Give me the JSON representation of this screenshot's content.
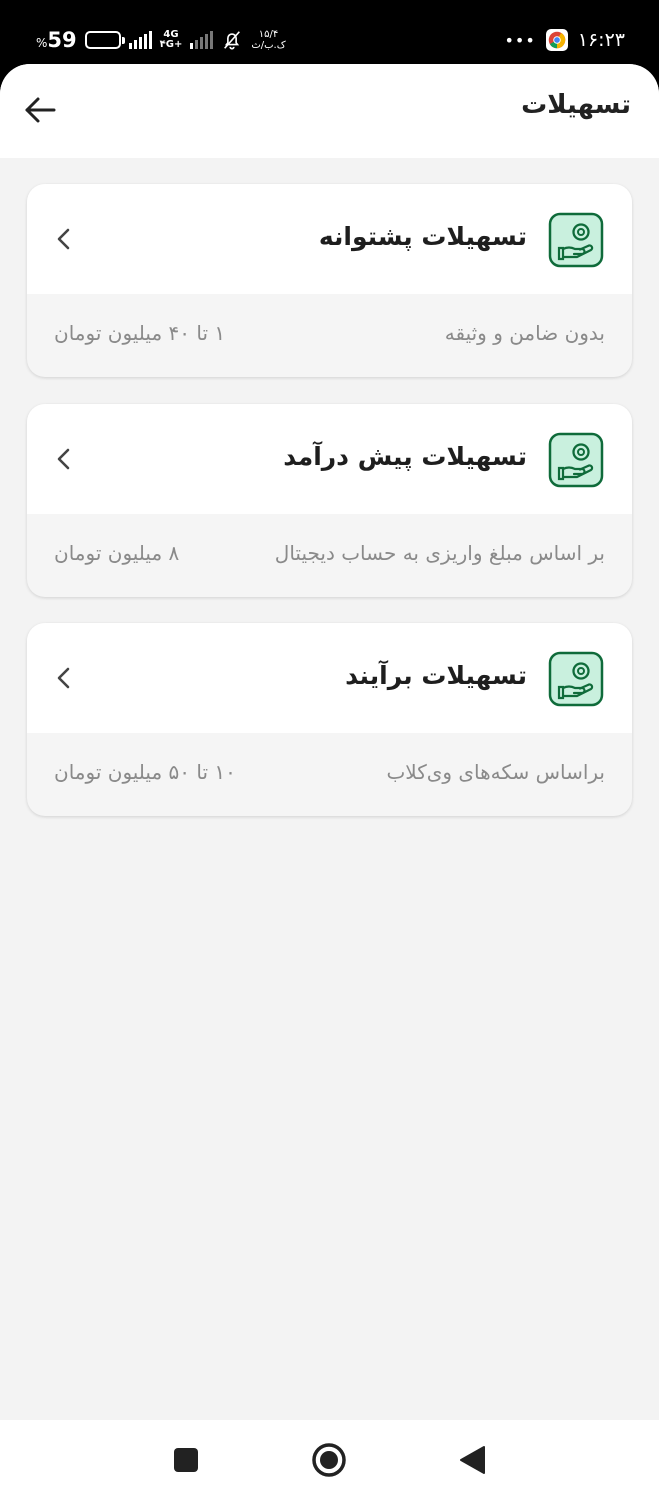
{
  "status_bar": {
    "battery_percent": "59",
    "battery_unit": "%",
    "network_type": "4G",
    "network_sub": "۴G+",
    "data_speed_value": "۱۵/۴",
    "data_speed_unit": "ک.ب/ث",
    "overflow_dots": "•••",
    "time": "۱۶:۲۳"
  },
  "header": {
    "title": "تسهیلات"
  },
  "cards": [
    {
      "title": "تسهیلات پشتوانه",
      "description": "بدون ضامن و وثیقه",
      "amount": "۱ تا ۴۰ میلیون تومان"
    },
    {
      "title": "تسهیلات پیش درآمد",
      "description": "بر اساس مبلغ واریزی به حساب دیجیتال",
      "amount": "۸ میلیون تومان"
    },
    {
      "title": "تسهیلات برآیند",
      "description": "براساس سکه‌های وی‌کلاب",
      "amount": "۱۰ تا ۵۰ میلیون تومان"
    }
  ],
  "colors": {
    "accent_green": "#0f6b3a",
    "icon_bg": "#c9f0de",
    "background": "#f3f3f3"
  },
  "icons": {
    "back": "arrow-left-icon",
    "card": "hand-coin-icon",
    "chevron": "chevron-left-icon",
    "nav": [
      "square-icon",
      "circle-icon",
      "triangle-back-icon"
    ]
  }
}
